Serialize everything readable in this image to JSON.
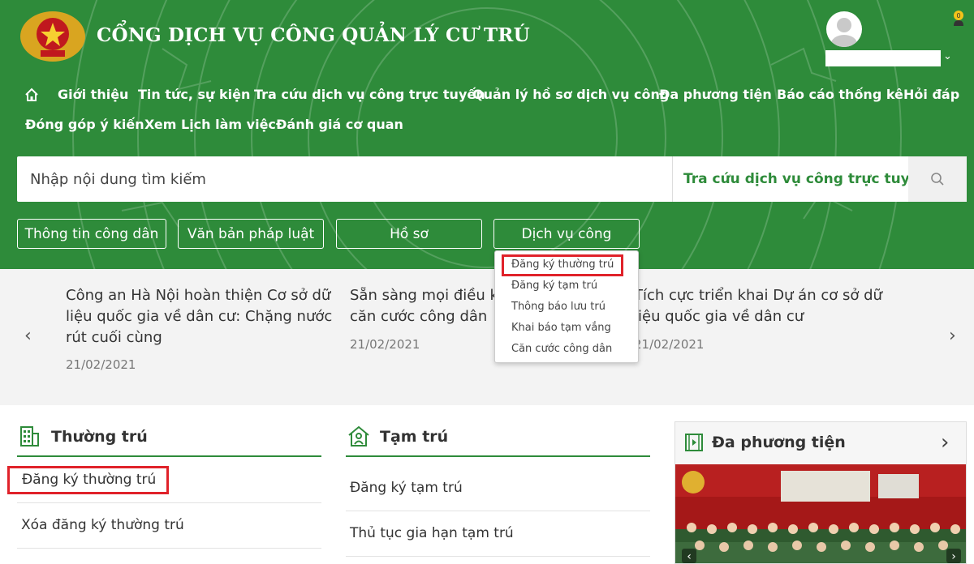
{
  "site": {
    "title": "CỔNG DỊCH VỤ CÔNG QUẢN LÝ CƯ TRÚ",
    "notification_count": "0"
  },
  "colors": {
    "brand_green": "#2e8b3a",
    "highlight_red": "#e0222a"
  },
  "nav": {
    "row1": [
      "Giới thiệu",
      "Tin tức, sự kiện",
      "Tra cứu dịch vụ công trực tuyến",
      "Quản lý hồ sơ dịch vụ công",
      "Đa phương tiện",
      "Báo cáo thống kê",
      "Hỏi đáp"
    ],
    "row2": [
      "Đóng góp ý kiến",
      "Xem Lịch làm việc",
      "Đánh giá cơ quan"
    ]
  },
  "search": {
    "placeholder": "Nhập nội dung tìm kiếm",
    "scope": "Tra cứu dịch vụ công trực tuyến"
  },
  "categories": [
    "Thông tin công dân",
    "Văn bản pháp luật",
    "Hồ sơ",
    "Dịch vụ công"
  ],
  "dropdown": [
    "Đăng ký thường trú",
    "Đăng ký tạm trú",
    "Thông báo lưu trú",
    "Khai báo tạm vắng",
    "Căn cước công dân"
  ],
  "news": [
    {
      "lines": [
        "Công an Hà Nội hoàn thiện Cơ sở dữ",
        "liệu quốc gia về dân cư: Chặng nước",
        "rút cuối cùng"
      ],
      "date": "21/02/2021"
    },
    {
      "lines": [
        "Sẵn sàng mọi điều ki",
        "căn cước công dân"
      ],
      "date": "21/02/2021"
    },
    {
      "lines": [
        "Tích cực triển khai Dự án cơ sở dữ",
        "liệu quốc gia về dân cư"
      ],
      "date": "21/02/2021"
    }
  ],
  "thuong_tru": {
    "title": "Thường trú",
    "links": [
      "Đăng ký thường trú",
      "Xóa đăng ký thường trú"
    ]
  },
  "tam_tru": {
    "title": "Tạm trú",
    "links": [
      "Đăng ký tạm trú",
      "Thủ tục gia hạn tạm trú"
    ]
  },
  "media": {
    "title": "Đa phương tiện"
  }
}
